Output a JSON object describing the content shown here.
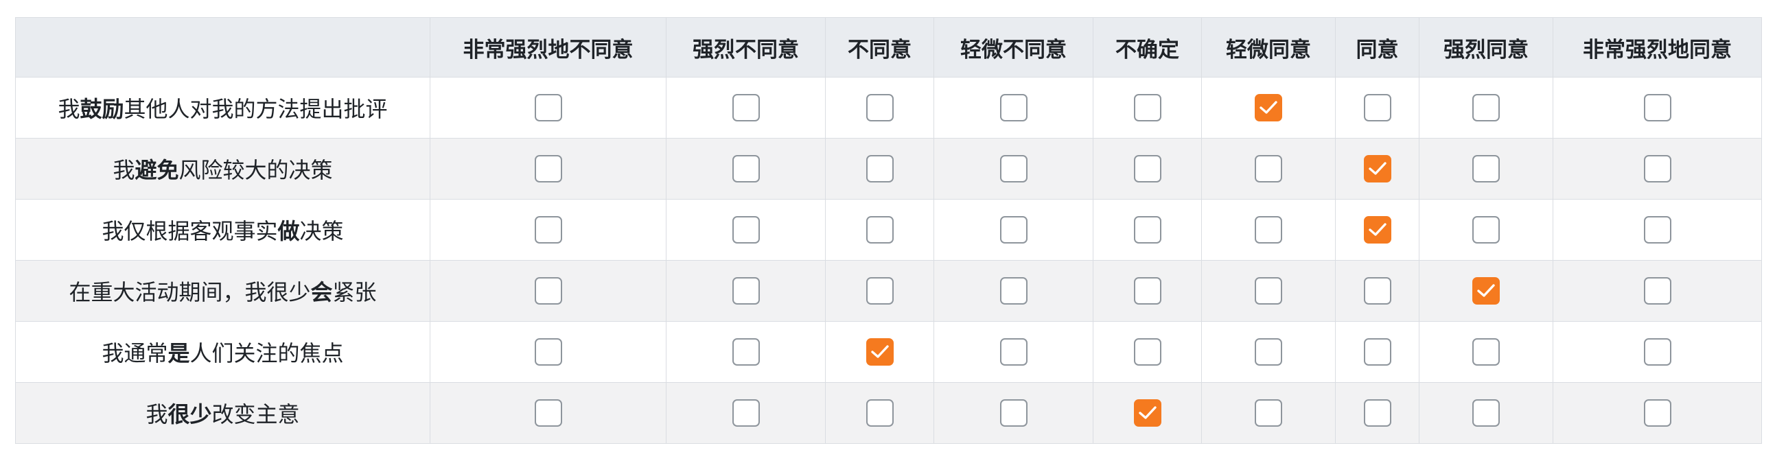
{
  "columns": [
    "",
    "非常强烈地不同意",
    "强烈不同意",
    "不同意",
    "轻微不同意",
    "不确定",
    "轻微同意",
    "同意",
    "强烈同意",
    "非常强烈地同意"
  ],
  "rows": [
    {
      "pre": "我",
      "bold": "鼓励",
      "post": "其他人对我的方法提出批评",
      "selected": 5
    },
    {
      "pre": "我",
      "bold": "避免",
      "post": "风险较大的决策",
      "selected": 6
    },
    {
      "pre": "我仅根据客观事实",
      "bold": "做",
      "post": "决策",
      "selected": 6
    },
    {
      "pre": "在重大活动期间，我很少",
      "bold": "会",
      "post": "紧张",
      "selected": 7
    },
    {
      "pre": "我通常",
      "bold": "是",
      "post": "人们关注的焦点",
      "selected": 2
    },
    {
      "pre": "我",
      "bold": "很少",
      "post": "改变主意",
      "selected": 4
    }
  ],
  "colors": {
    "checked": "#f57a1f",
    "border": "#8e959c",
    "header_bg": "#e9ecf0",
    "stripe_bg": "#f2f2f3"
  },
  "icons": {
    "check": "checkmark-icon"
  }
}
